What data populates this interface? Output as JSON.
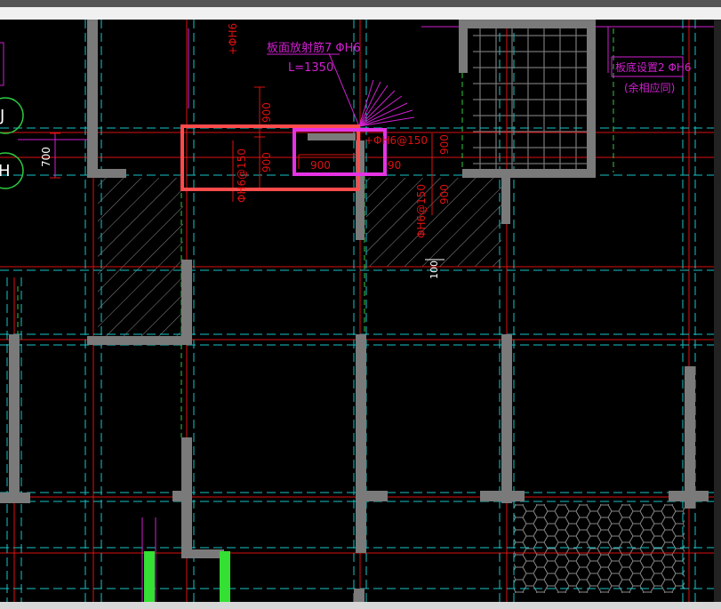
{
  "drawing": {
    "labels": {
      "callout_top": "板面放射筋7 ΦH6",
      "callout_length": "L=1350",
      "callout_right": "板底设置2 ΦH6",
      "callout_right_sub": "(余相应同)",
      "grid_bubble_j": "J",
      "grid_bubble_h": "H",
      "dim_700": "700",
      "dim_900_a": "900",
      "dim_900_b": "900",
      "dim_900_c": "900",
      "dim_900_d": "900",
      "dim_900_e": "900",
      "rebar_a": "ΦH6@150",
      "rebar_b": "+ΦH6@150",
      "rebar_c": "ΦH6@150",
      "rebar_top": "+ΦH6",
      "dim_100": "100",
      "dim_90": "90"
    },
    "highlight_colors": {
      "red_box": "#ff4b4b",
      "magenta_box": "#e533e5"
    }
  }
}
